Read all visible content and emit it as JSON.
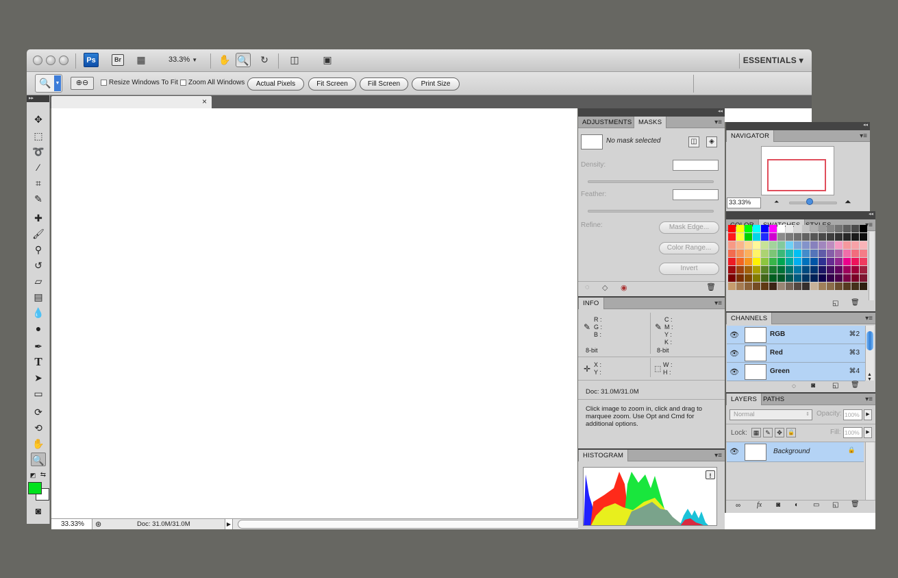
{
  "app_bar": {
    "ps_logo": "Ps",
    "bridge_logo": "Br",
    "zoom_level": "33.3%",
    "workspace": "ESSENTIALS ▾"
  },
  "options_bar": {
    "resize_windows": "Resize Windows To Fit",
    "zoom_all": "Zoom All Windows",
    "buttons": [
      "Actual Pixels",
      "Fit Screen",
      "Fill Screen",
      "Print Size"
    ]
  },
  "document": {
    "close_glyph": "×",
    "status_zoom": "33.33%",
    "status_doc": "Doc: 31.0M/31.0M"
  },
  "masks_panel": {
    "tabs": [
      "ADJUSTMENTS",
      "MASKS"
    ],
    "active_tab": "MASKS",
    "no_mask": "No mask selected",
    "density_label": "Density:",
    "feather_label": "Feather:",
    "refine_label": "Refine:",
    "buttons": [
      "Mask Edge...",
      "Color Range...",
      "Invert"
    ]
  },
  "info_panel": {
    "tab": "INFO",
    "rgb": "R :\nG :\nB :",
    "cmyk": "C :\nM :\nY :\nK :",
    "bit_left": "8-bit",
    "bit_right": "8-bit",
    "xy": "X :\nY :",
    "wh": "W :\nH :",
    "doc": "Doc: 31.0M/31.0M",
    "hint": "Click image to zoom in, click and drag to marquee zoom.  Use Opt and Cmd for additional options."
  },
  "histogram_panel": {
    "tab": "HISTOGRAM",
    "warning_glyph": "!"
  },
  "navigator_panel": {
    "tab": "NAVIGATOR",
    "zoom": "33.33%"
  },
  "swatches_panel": {
    "tabs": [
      "COLOR",
      "SWATCHES",
      "STYLES"
    ],
    "active_tab": "SWATCHES",
    "colors": [
      "#ff0000",
      "#ffff00",
      "#00ff00",
      "#00ffff",
      "#0000ff",
      "#ff00ff",
      "#ffffff",
      "#ebebeb",
      "#d7d7d7",
      "#c3c3c3",
      "#afafaf",
      "#9b9b9b",
      "#878787",
      "#737373",
      "#5f5f5f",
      "#4b4b4b",
      "#000000",
      "#ff1a1a",
      "#ffff33",
      "#00d000",
      "#00d5e8",
      "#1e2cff",
      "#d000d0",
      "#8c8c8c",
      "#7a7a7a",
      "#6e6e6e",
      "#626262",
      "#565656",
      "#4a4a4a",
      "#3e3e3e",
      "#323232",
      "#262626",
      "#1a1a1a",
      "#0d0d0d",
      "#f79a85",
      "#f9b58b",
      "#fdd590",
      "#fff799",
      "#c7e297",
      "#a3d39c",
      "#82ca9d",
      "#6dcff6",
      "#7da7d9",
      "#8393ca",
      "#8781bd",
      "#a186be",
      "#bd8cbf",
      "#f49ac2",
      "#f5989d",
      "#f6a2a7",
      "#f8b4b8",
      "#f26c4f",
      "#f68e55",
      "#fbaf5c",
      "#fff467",
      "#acd372",
      "#7cc576",
      "#3bb878",
      "#1abbb4",
      "#00bff3",
      "#438ccb",
      "#5574b9",
      "#605ca8",
      "#855fa8",
      "#a763a8",
      "#f06ea9",
      "#f26d7d",
      "#f47d87",
      "#ed1c24",
      "#f26522",
      "#f7941d",
      "#fff200",
      "#8dc63f",
      "#39b54a",
      "#00a651",
      "#00a99d",
      "#00aeef",
      "#0072bc",
      "#0054a6",
      "#2e3192",
      "#662d91",
      "#92278f",
      "#ec008c",
      "#ed145b",
      "#ef3b5f",
      "#9e0b0f",
      "#a0410d",
      "#a36209",
      "#aba000",
      "#598527",
      "#1a7b30",
      "#007236",
      "#00746b",
      "#0076a3",
      "#004b80",
      "#003471",
      "#1b1464",
      "#440e62",
      "#630460",
      "#9e005d",
      "#9e0039",
      "#a0203f",
      "#790000",
      "#7b2e00",
      "#7d4900",
      "#827b00",
      "#406618",
      "#005e20",
      "#005826",
      "#005952",
      "#005b7f",
      "#003663",
      "#002157",
      "#0d004c",
      "#32004b",
      "#4b0049",
      "#7b0046",
      "#7a0026",
      "#7d1530",
      "#c69c6d",
      "#a67c52",
      "#8c6239",
      "#754c24",
      "#603913",
      "#3c2415",
      "#998675",
      "#736357",
      "#534741",
      "#362f2d",
      "#c7b299",
      "#a0805b",
      "#8b6d4b",
      "#6b4d2f",
      "#563b20",
      "#44301a",
      "#2e2010"
    ]
  },
  "channels_panel": {
    "tab": "CHANNELS",
    "rows": [
      {
        "name": "RGB",
        "shortcut": "⌘2"
      },
      {
        "name": "Red",
        "shortcut": "⌘3"
      },
      {
        "name": "Green",
        "shortcut": "⌘4"
      }
    ]
  },
  "layers_panel": {
    "tabs": [
      "LAYERS",
      "PATHS"
    ],
    "active_tab": "LAYERS",
    "blend_mode": "Normal",
    "opacity_label": "Opacity:",
    "opacity_value": "100%",
    "lock_label": "Lock:",
    "fill_label": "Fill:",
    "fill_value": "100%",
    "layer_name": "Background"
  },
  "icons": {
    "eye": "👁",
    "lock": "🔒",
    "trash": "🗑",
    "menu": "▾≡",
    "collapse": "◂◂",
    "grip": "▸▸"
  }
}
